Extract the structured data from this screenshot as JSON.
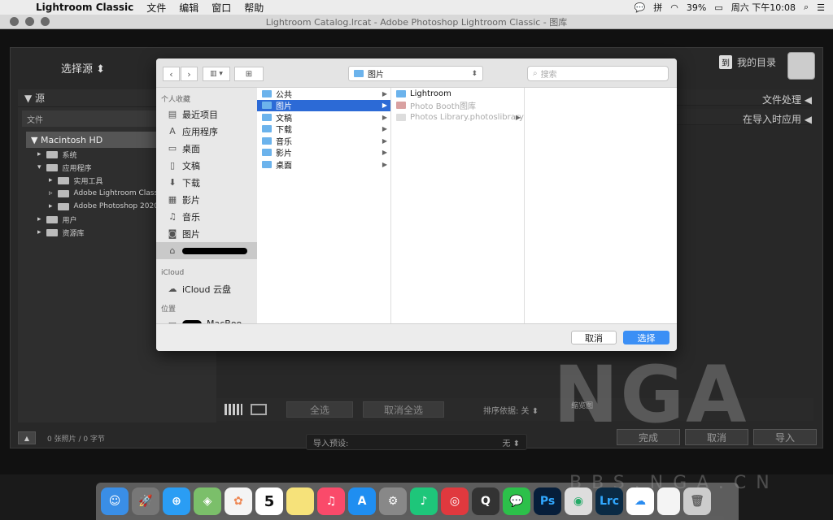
{
  "menubar": {
    "app": "Lightroom Classic",
    "menus": [
      "文件",
      "编辑",
      "窗口",
      "帮助"
    ],
    "ime": "拼",
    "battery": "39%",
    "clock": "周六 下午10:08"
  },
  "window": {
    "title": "Lightroom Catalog.lrcat - Adobe Photoshop Lightroom Classic - 图库"
  },
  "import": {
    "source_selector": "选择源 ⬍",
    "dest_badge": "到",
    "dest_label": "我的目录",
    "left_panel": {
      "header": "▼  源",
      "file_label": "文件",
      "drive": "▼  Macintosh HD",
      "tree": [
        {
          "label": "系统",
          "indent": 0
        },
        {
          "label": "应用程序",
          "indent": 0
        },
        {
          "label": "实用工具",
          "indent": 1
        },
        {
          "label": "Adobe Lightroom Classic",
          "indent": 1
        },
        {
          "label": "Adobe Photoshop 2020",
          "indent": 1
        },
        {
          "label": "用户",
          "indent": 0
        },
        {
          "label": "资源库",
          "indent": 0
        }
      ]
    },
    "right_panels": [
      "文件处理  ◀",
      "在导入时应用  ◀"
    ],
    "bottom": {
      "select_all": "全选",
      "deselect_all": "取消全选",
      "sort_label": "排序依据:  关  ⬍",
      "thumb_label": "缩览图"
    },
    "status": {
      "count": "0 张照片 / 0 字节",
      "preset_label": "导入预设:",
      "preset_value": "无  ⬍",
      "done": "完成",
      "cancel": "取消",
      "import": "导入"
    }
  },
  "dialog": {
    "location": "图片",
    "search_placeholder": "搜索",
    "sidebar": {
      "favorites_header": "个人收藏",
      "favorites": [
        {
          "label": "最近项目",
          "icon": "recent-icon",
          "glyph": "▤"
        },
        {
          "label": "应用程序",
          "icon": "applications-icon",
          "glyph": "A"
        },
        {
          "label": "桌面",
          "icon": "desktop-icon",
          "glyph": "▭"
        },
        {
          "label": "文稿",
          "icon": "documents-icon",
          "glyph": "▯"
        },
        {
          "label": "下载",
          "icon": "downloads-icon",
          "glyph": "⬇"
        },
        {
          "label": "影片",
          "icon": "movies-icon",
          "glyph": "▦"
        },
        {
          "label": "音乐",
          "icon": "music-icon",
          "glyph": "♫"
        },
        {
          "label": "图片",
          "icon": "pictures-icon",
          "glyph": "◙"
        }
      ],
      "icloud_header": "iCloud",
      "icloud_item": "iCloud 云盘",
      "locations_header": "位置",
      "location_item": "MacBoo..."
    },
    "column1": [
      {
        "label": "公共",
        "selected": false
      },
      {
        "label": "图片",
        "selected": true
      },
      {
        "label": "文稿",
        "selected": false
      },
      {
        "label": "下载",
        "selected": false
      },
      {
        "label": "音乐",
        "selected": false
      },
      {
        "label": "影片",
        "selected": false
      },
      {
        "label": "桌面",
        "selected": false
      }
    ],
    "column2": [
      {
        "label": "Lightroom",
        "disabled": false
      },
      {
        "label": "Photo Booth图库",
        "disabled": true
      },
      {
        "label": "Photos Library.photoslibrary",
        "disabled": true
      }
    ],
    "cancel": "取消",
    "choose": "选择"
  },
  "dock": {
    "apps": [
      "finder-icon",
      "launchpad-icon",
      "safari-icon",
      "maps-icon",
      "photos-icon",
      "calendar-icon",
      "notes-icon",
      "music-icon",
      "appstore-icon",
      "system-preferences-icon",
      "qqmusic-icon",
      "netease-music-icon",
      "quicktime-icon",
      "wechat-icon",
      "photoshop-icon",
      "lightroom-cc-icon",
      "lightroom-classic-icon",
      "baidu-netdisk-icon",
      "document-icon",
      "trash-icon"
    ],
    "calendar_day": "5",
    "ps_label": "Ps",
    "lrc_label": "Lrc"
  },
  "watermark": {
    "brand": "NGA",
    "url": "BBS.NGA.CN"
  }
}
